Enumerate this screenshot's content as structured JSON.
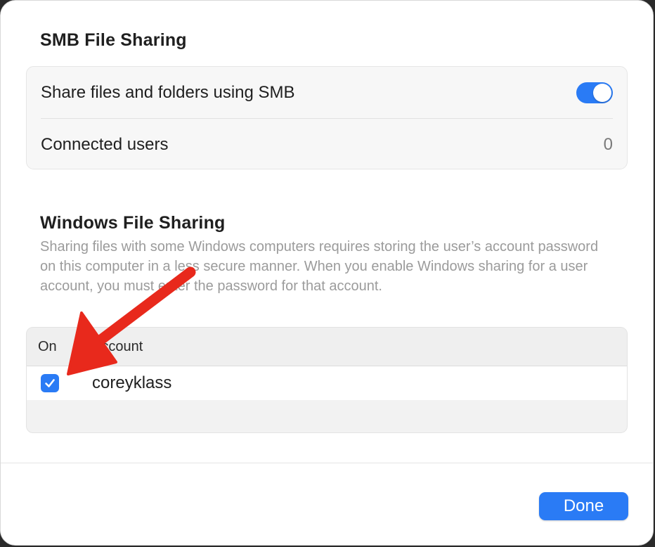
{
  "smb": {
    "title": "SMB File Sharing",
    "share_label": "Share files and folders using SMB",
    "share_enabled": true,
    "connected_label": "Connected users",
    "connected_count": "0"
  },
  "windows": {
    "title": "Windows File Sharing",
    "description": "Sharing files with some Windows computers requires storing the user’s account password on this computer in a less secure manner. When you enable Windows sharing for a user account, you must enter the password for that account.",
    "table": {
      "headers": [
        "On",
        "Account"
      ],
      "rows": [
        {
          "on": true,
          "account": "coreyklass"
        }
      ]
    }
  },
  "footer": {
    "done_label": "Done"
  },
  "colors": {
    "accent": "#2a7bf5",
    "annotation": "#e8291c"
  },
  "icons": {
    "checkbox": "checkmark-icon",
    "annotation": "red-arrow-annotation"
  }
}
